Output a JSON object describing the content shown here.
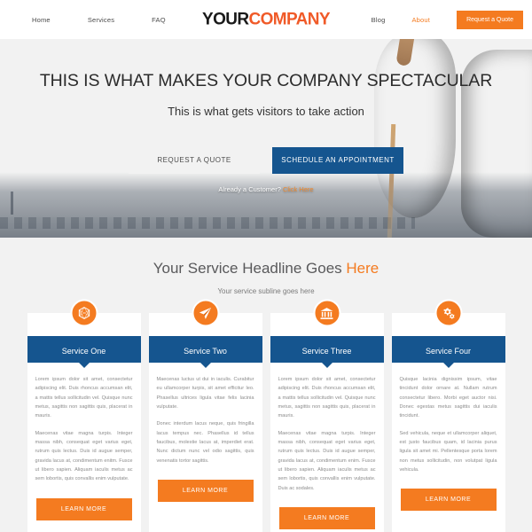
{
  "header": {
    "nav_left": [
      {
        "label": "Home",
        "active": false
      },
      {
        "label": "Services",
        "active": false
      },
      {
        "label": "FAQ",
        "active": false
      }
    ],
    "nav_right": [
      {
        "label": "Blog",
        "active": false
      },
      {
        "label": "About",
        "active": true
      }
    ],
    "logo_first": "YOUR",
    "logo_second": "COMPANY",
    "quote_button": "Request a Quote"
  },
  "hero": {
    "title": "THIS IS WHAT MAKES YOUR COMPANY SPECTACULAR",
    "subtitle": "This is what gets visitors to take action",
    "primary_button": "REQUEST A QUOTE",
    "secondary_button": "SCHEDULE AN APPOINTMENT",
    "already_text": "Already a Customer?",
    "already_link": "Click Here"
  },
  "services": {
    "headline_main": "Your Service Headline Goes ",
    "headline_accent": "Here",
    "subline": "Your service subline goes here",
    "cards": [
      {
        "icon": "hexagon-molecule-icon",
        "title": "Service One",
        "paragraph1": "Lorem ipsum dolor sit amet, consectetur adipiscing elit. Duis rhoncus accumsan elit, a mattis tellus sollicitudin vel. Quisque nunc metus, sagittis non sagittis quis, placerat in mauris.",
        "paragraph2": "Maecenas vitae magna turpis. Integer massa nibh, consequat eget varius eget, rutrum quis lectus. Duis id augue semper, gravida lacus at, condimentum enitm. Fusce ut libero sapien. Aliquam iaculis metus ac sem lobortis, quis convallis enim vulputate.",
        "button": "LEARN MORE"
      },
      {
        "icon": "paper-plane-icon",
        "title": "Service Two",
        "paragraph1": "Maecenas luctus ut dui in iaculis. Curabitur eu ullamcorper turpis, sit amet efficitur leo. Phasellus ultrices ligula vitae felis lacinia vulputate.",
        "paragraph2": "Donec interdum lacus neque, quis fringilla lacus tempus nec. Phasellus id tellus faucibus, molestie lacus at, imperdiet erat. Nunc dictum nunc vel odio sagittis, quis venenatis tortor sagittis.",
        "button": "LEARN MORE"
      },
      {
        "icon": "bank-building-icon",
        "title": "Service Three",
        "paragraph1": "Lorem ipsum dolor sit amet, consectetur adipiscing elit. Duis rhoncus accumsan elit, a mattis tellus sollicitudin vel. Quisque nunc metus, sagittis non sagittis quis, placerat in mauris.",
        "paragraph2": "Maecenas vitae magna turpis. Integer massa nibh, consequat eget varius eget, rutrum quis lectus. Duis id augue semper, gravida lacus at, condimentum enim. Fusce ut libero sapien. Aliquam iaculis metus ac sem lobortis, quis convallis enim vulputate. Duis ac sodales.",
        "button": "LEARN MORE"
      },
      {
        "icon": "gears-icon",
        "title": "Service Four",
        "paragraph1": "Quisque lacinia dignissim ipsum, vitae tincidunt dolor ornare at. Nullam rutrum consectetur libero. Morbi eget auctor nisi. Donec egestas metus sagittis dui iaculis tincidunt.",
        "paragraph2": "Sed vehicula, neque et ullamcorper aliquet, est justo faucibus quam, id lacinia purus ligula sit amet mi. Pellentesque porta lorem non metus sollicitudin, non volutpat ligula vehicula.",
        "button": "LEARN MORE"
      }
    ]
  },
  "colors": {
    "orange": "#f47b20",
    "logo_orange": "#f05a28",
    "blue": "#15558f",
    "page_bg": "#f2f2f2",
    "body_text": "#8c8c8c"
  }
}
